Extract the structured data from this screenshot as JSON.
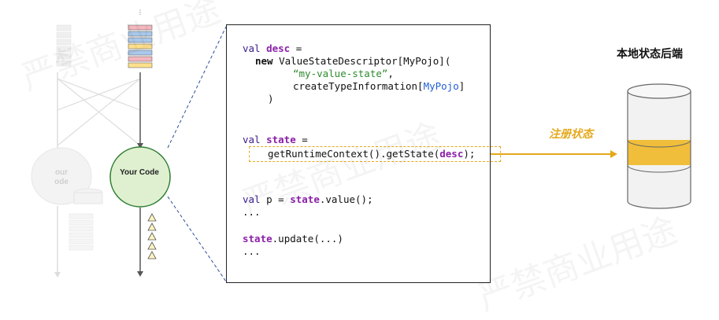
{
  "code": {
    "line1": {
      "kw": "val ",
      "var": "desc",
      "rest": " ="
    },
    "line2": {
      "kw": "new",
      "rest": " ValueStateDescriptor[MyPojo]("
    },
    "line3": {
      "str": "“my-value-state”",
      "rest": ","
    },
    "line4": {
      "pre": "createTypeInformation[",
      "type": "MyPojo",
      "post": "]"
    },
    "line5": ")",
    "line6": {
      "kw": "val ",
      "var": "state",
      "rest": " ="
    },
    "line7": {
      "pre": "getRuntimeContext().getState(",
      "var": "desc",
      "post": ");"
    },
    "line8": {
      "kw": "val ",
      "pre": "p = ",
      "var": "state",
      "post": ".value();"
    },
    "line9": "...",
    "line10": {
      "var": "state",
      "post": ".update(...)"
    },
    "line11": "..."
  },
  "labels": {
    "backend_title": "本地状态后端",
    "register": "注册状态",
    "your_code": "Your Code",
    "ghost_code_1": "our",
    "ghost_code_2": "ode"
  },
  "colors": {
    "accent": "#e5a81c",
    "your_code_fill": "#dff0d0",
    "your_code_stroke": "#2e7d32",
    "record_pink": "#f4b6bf",
    "record_blue": "#a9c8ec",
    "record_yellow": "#ffe08a"
  },
  "watermark": [
    "严禁商业用途",
    "严禁商业用途",
    "严禁商业用途"
  ]
}
